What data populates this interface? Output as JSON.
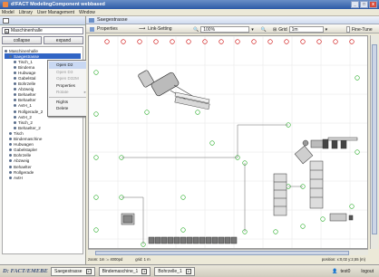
{
  "window": {
    "title": "d!FACT ModelingComponent webbased",
    "min": "_",
    "max": "□",
    "close": "x"
  },
  "menu": [
    "Model",
    "Library",
    "User Management",
    "Window"
  ],
  "left_panel": {
    "tab_label": "Maschinenhalle",
    "collapse_label": "collapse",
    "expand_label": "expand",
    "tree_items": [
      {
        "label": "Maschinenhalle",
        "level": 0
      },
      {
        "label": "Saegestrasse",
        "level": 1,
        "selected": true
      },
      {
        "label": "Tisch_1",
        "level": 2
      },
      {
        "label": "Bindema",
        "level": 2
      },
      {
        "label": "Hubwage",
        "level": 2
      },
      {
        "label": "Gabelstal",
        "level": 2
      },
      {
        "label": "Bohrzelle",
        "level": 2
      },
      {
        "label": "Abzweig",
        "level": 2
      },
      {
        "label": "Behaelter",
        "level": 2
      },
      {
        "label": "Behaelter",
        "level": 2
      },
      {
        "label": "AvtH_1",
        "level": 2
      },
      {
        "label": "Rollgerade_2",
        "level": 2
      },
      {
        "label": "AvtH_2",
        "level": 2
      },
      {
        "label": "Tisch_2",
        "level": 2
      },
      {
        "label": "Behaelter_2",
        "level": 2
      },
      {
        "label": "Tisch",
        "level": 1
      },
      {
        "label": "Bindemaschine",
        "level": 1
      },
      {
        "label": "Hubwagen",
        "level": 1
      },
      {
        "label": "Gabelstapler",
        "level": 1
      },
      {
        "label": "Bohrzelle",
        "level": 1
      },
      {
        "label": "Abzweig",
        "level": 1
      },
      {
        "label": "Behaelter",
        "level": 1
      },
      {
        "label": "Rollgerade",
        "level": 1
      },
      {
        "label": "AvtH",
        "level": 1
      }
    ]
  },
  "context_menu": {
    "items": [
      {
        "label": "Open D2",
        "state": "highlight"
      },
      {
        "label": "Open D3",
        "state": "disabled"
      },
      {
        "label": "Open D32M",
        "state": "disabled"
      },
      {
        "label": "Properties",
        "state": "normal"
      },
      {
        "label": "Rotate",
        "state": "disabled",
        "submenu": true
      },
      {
        "label": "Rights",
        "state": "normal"
      },
      {
        "label": "Delete",
        "state": "normal"
      }
    ]
  },
  "editor": {
    "tab_title": "Saegestrasse",
    "toolbar": {
      "properties_label": "Properties",
      "link_setting_label": "Link-Setting",
      "zoom_value": "100%",
      "grid_label": "Grid",
      "grid_value": "1m",
      "fine_tune_label": "Fine-Tune"
    },
    "status": {
      "zoom": "zoom: 1m := 4000pd",
      "grid": "grid: 1 m",
      "position": "position: x:0,02  y:2,55 (m)"
    }
  },
  "taskbar": {
    "logo": "D: FACT/EMEBE",
    "tasks": [
      "Saegestrasse",
      "Bindemaschine_1",
      "Bohrzelle_1"
    ],
    "user": "test0",
    "logout": "logout"
  }
}
